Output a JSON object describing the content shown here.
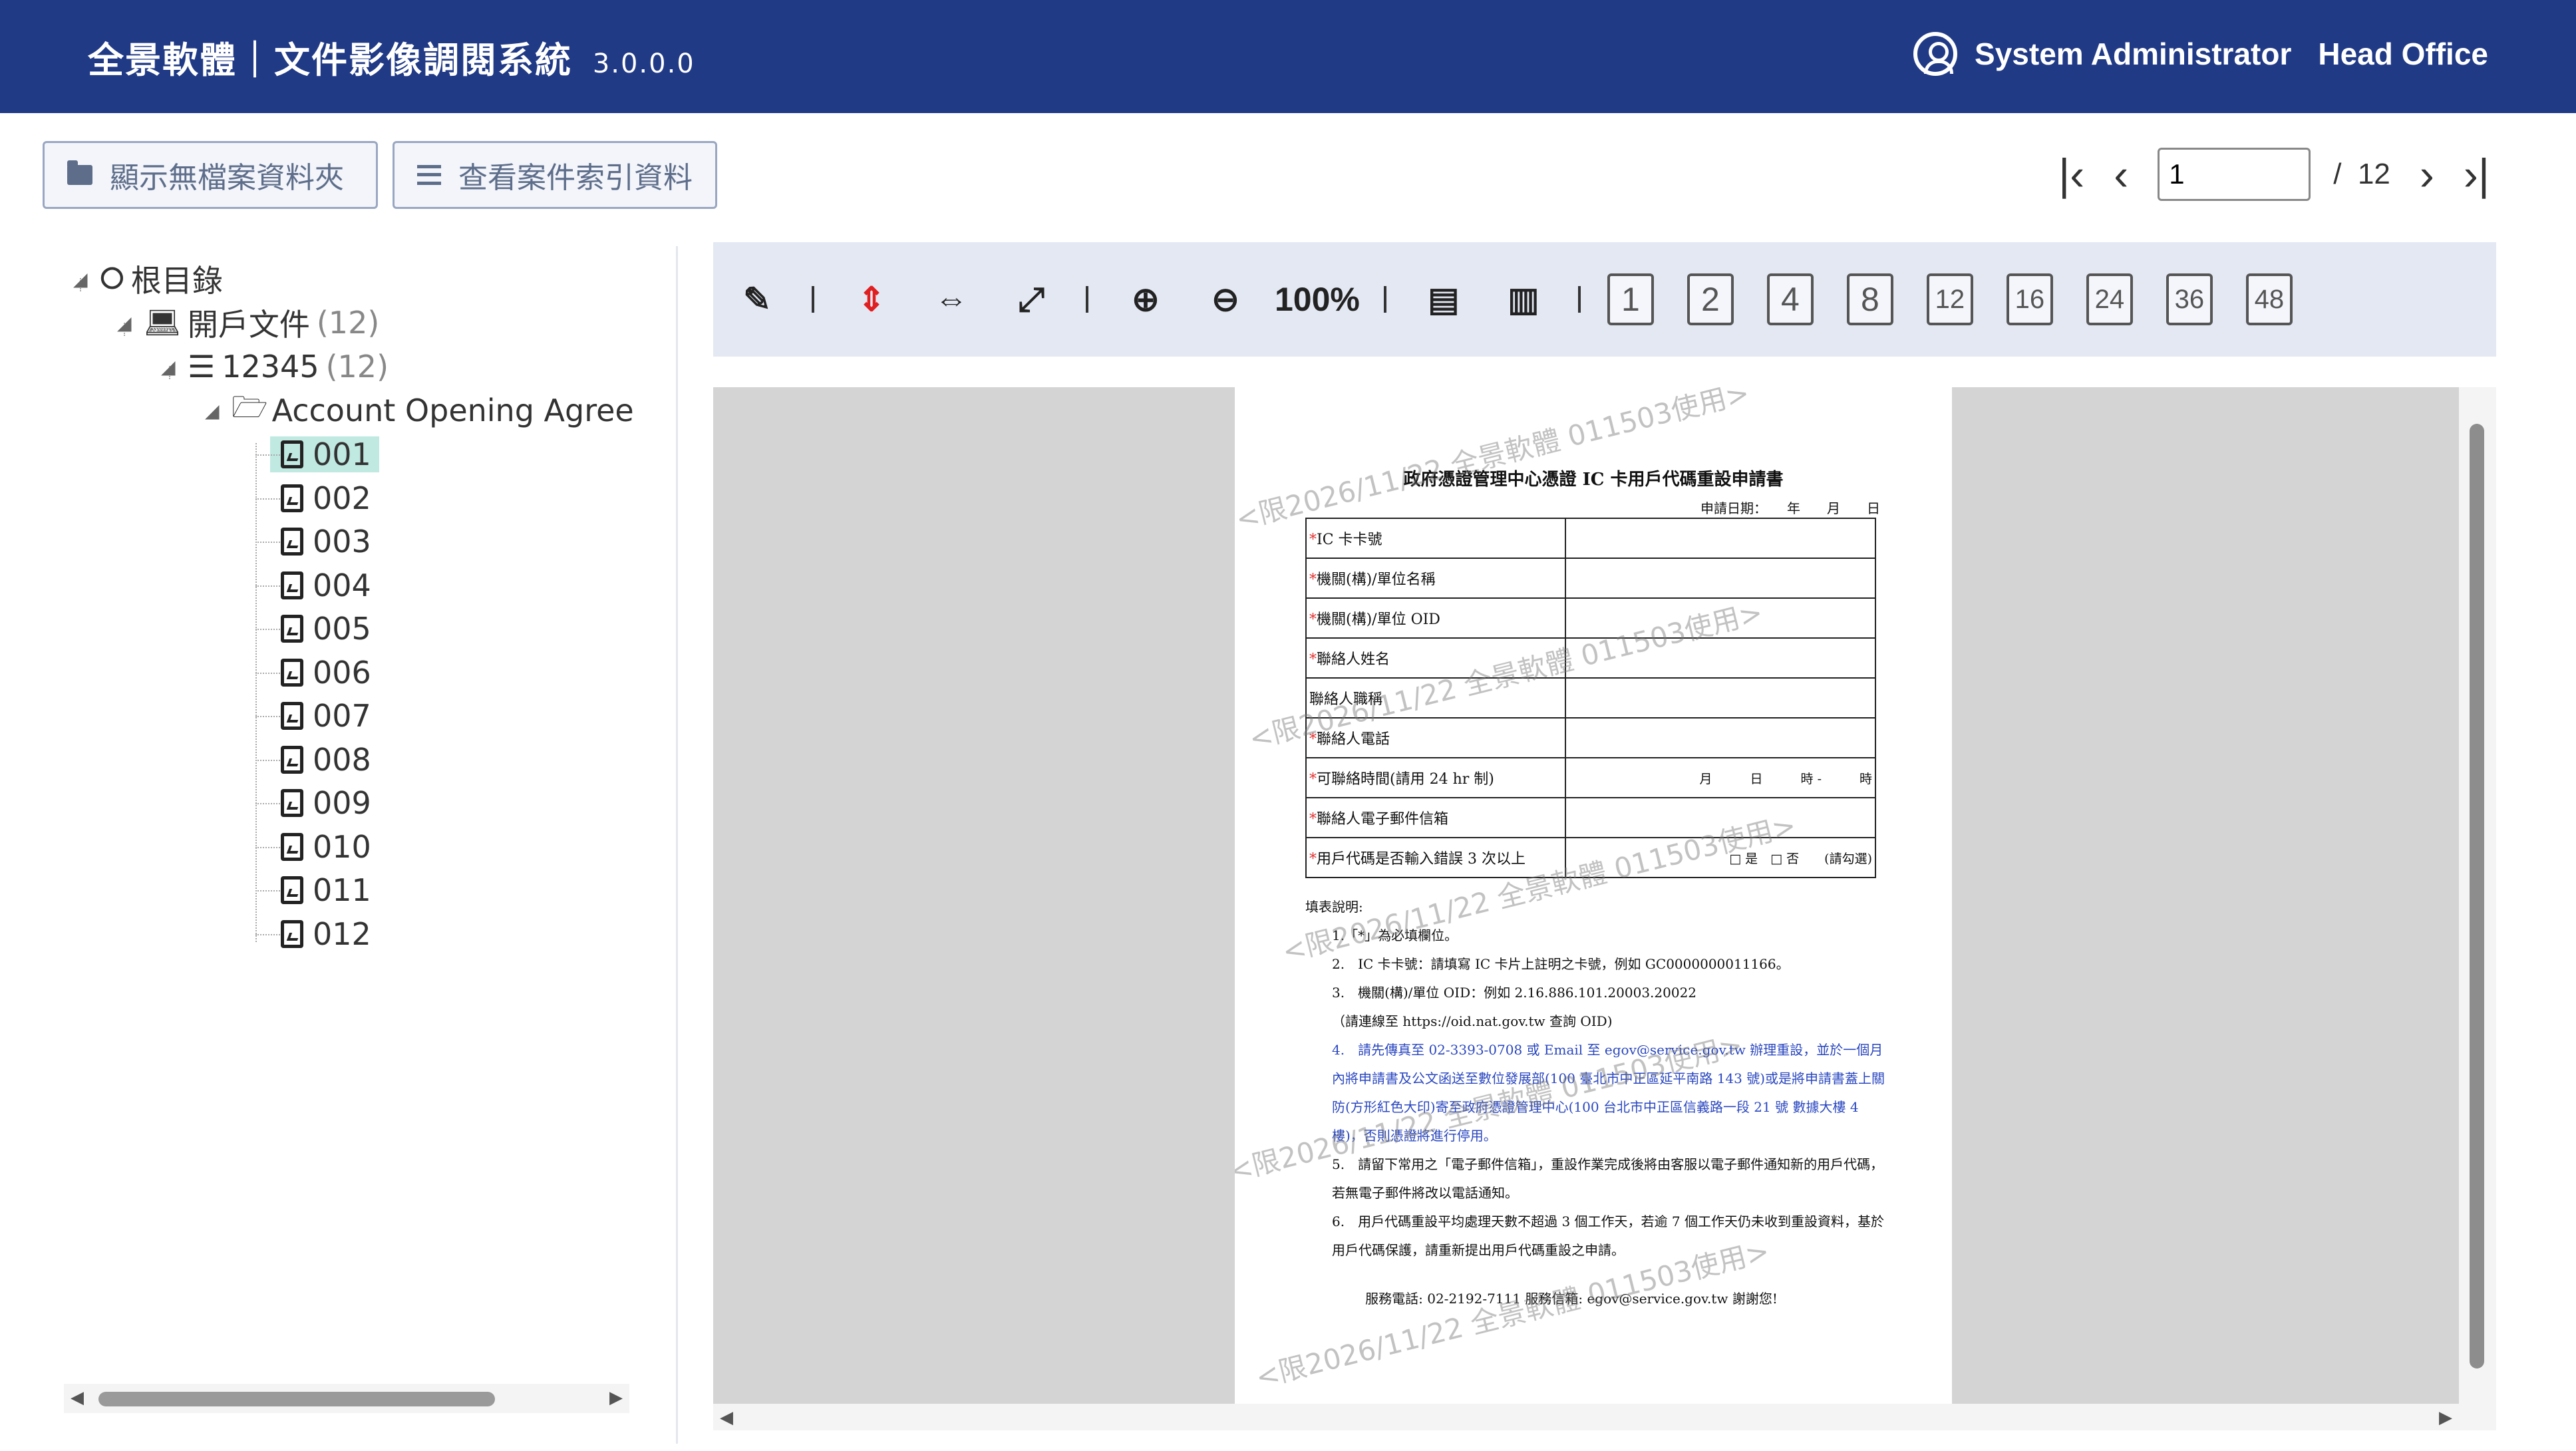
{
  "header": {
    "title": "全景軟體｜文件影像調閱系統",
    "version": "3.0.0.0",
    "user": "System Administrator",
    "branch": "Head Office"
  },
  "actions": {
    "show_folders": "顯示無檔案資料夾",
    "view_index": "查看案件索引資料"
  },
  "pager": {
    "current": "1",
    "separator": "/",
    "total": "12"
  },
  "tree": {
    "root": "根目錄",
    "level1": {
      "label": "開戶文件",
      "count": "(12)"
    },
    "level2": {
      "label": "12345",
      "count": "(12)"
    },
    "level3": {
      "label": "Account Opening Agree"
    },
    "files": [
      "001",
      "002",
      "003",
      "004",
      "005",
      "006",
      "007",
      "008",
      "009",
      "010",
      "011",
      "012"
    ],
    "selected": "001"
  },
  "toolbar": {
    "zoom": "100%",
    "page_counts": [
      "1",
      "2",
      "4",
      "8",
      "12",
      "16",
      "24",
      "36",
      "48"
    ]
  },
  "document": {
    "title": "政府憑證管理中心憑證 IC 卡用戶代碼重設申請書",
    "date_label": "申請日期：　　年　　月　　日",
    "rows": [
      {
        "req": "*",
        "label": "IC 卡卡號",
        "value": ""
      },
      {
        "req": "*",
        "label": "機關(構)/單位名稱",
        "value": ""
      },
      {
        "req": "*",
        "label": "機關(構)/單位 OID",
        "value": ""
      },
      {
        "req": "*",
        "label": "聯絡人姓名",
        "value": ""
      },
      {
        "req": "",
        "label": "聯絡人職稱",
        "value": ""
      },
      {
        "req": "*",
        "label": "聯絡人電話",
        "value": ""
      },
      {
        "req": "*",
        "label": "可聯絡時間(請用 24 hr 制)",
        "value": "月　　　日　　　時 -　　　時"
      },
      {
        "req": "*",
        "label": "聯絡人電子郵件信箱",
        "value": ""
      },
      {
        "req": "*",
        "label": "用戶代碼是否輸入錯誤 3 次以上",
        "value": "□ 是　□ 否　　(請勾選)"
      }
    ],
    "notes_title": "填表說明:",
    "notes": [
      "1.「*」為必填欄位。",
      "2.　IC 卡卡號：請填寫 IC 卡片上註明之卡號，例如 GC0000000011166。",
      "3.　機關(構)/單位 OID：例如 2.16.886.101.20003.20022",
      "（請連線至 https://oid.nat.gov.tw 查詢 OID)",
      "4.　請先傳真至 02-3393-0708 或 Email 至 egov@service.gov.tw 辦理重設，並於一個月內將申請書及公文函送至數位發展部(100 臺北市中正區延平南路 143 號)或是將申請書蓋上關防(方形紅色大印)寄至政府憑證管理中心(100 台北市中正區信義路一段 21 號 數據大樓 4 樓)，否則憑證將進行停用。",
      "5.　請留下常用之「電子郵件信箱」，重設作業完成後將由客服以電子郵件通知新的用戶代碼，若無電子郵件將改以電話通知。",
      "6.　用戶代碼重設平均處理天數不超過 3 個工作天，若逾 7 個工作天仍未收到重設資料，基於用戶代碼保護，請重新提出用戶代碼重設之申請。"
    ],
    "footer": "服務電話: 02-2192-7111 服務信箱: egov@service.gov.tw  謝謝您!",
    "watermark": "<限2026/11/22 全景軟體 011503使用>"
  }
}
